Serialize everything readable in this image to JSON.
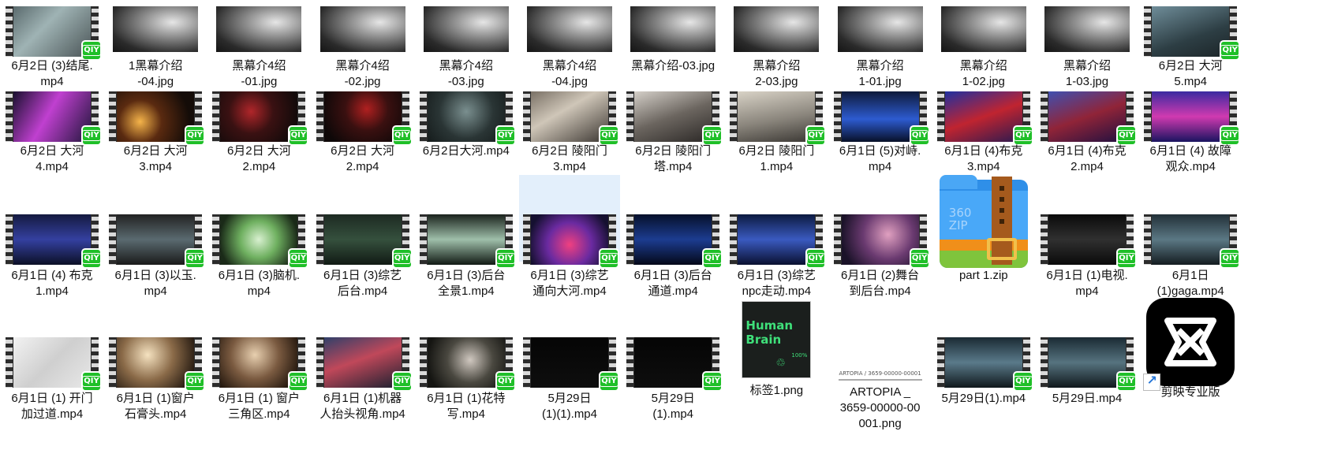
{
  "files": [
    {
      "name": "6月2日 (3)结尾.mp4",
      "type": "video",
      "label_lines": [
        "6月2日 (3)结尾.",
        "mp4"
      ],
      "frame": "linear-gradient(135deg,#5a6a6d,#9fb3b4 40%,#4b5557)"
    },
    {
      "name": "1黑幕介绍-04.jpg",
      "type": "image",
      "label_lines": [
        "1黑幕介绍",
        "-04.jpg"
      ]
    },
    {
      "name": "黑幕介4绍-01.jpg",
      "type": "image",
      "label_lines": [
        "黑幕介4绍",
        "-01.jpg"
      ]
    },
    {
      "name": "黑幕介4绍-02.jpg",
      "type": "image",
      "label_lines": [
        "黑幕介4绍",
        "-02.jpg"
      ]
    },
    {
      "name": "黑幕介4绍-03.jpg",
      "type": "image",
      "label_lines": [
        "黑幕介4绍",
        "-03.jpg"
      ]
    },
    {
      "name": "黑幕介4绍-04.jpg",
      "type": "image",
      "label_lines": [
        "黑幕介4绍",
        "-04.jpg"
      ]
    },
    {
      "name": "黑幕介绍-03.jpg",
      "type": "image",
      "label_lines": [
        "黑幕介绍-03.jpg"
      ]
    },
    {
      "name": "黑幕介绍2-03.jpg",
      "type": "image",
      "label_lines": [
        "黑幕介绍",
        "2-03.jpg"
      ]
    },
    {
      "name": "黑幕介绍1-01.jpg",
      "type": "image",
      "label_lines": [
        "黑幕介绍",
        "1-01.jpg"
      ]
    },
    {
      "name": "黑幕介绍1-02.jpg",
      "type": "image",
      "label_lines": [
        "黑幕介绍",
        "1-02.jpg"
      ]
    },
    {
      "name": "黑幕介绍1-03.jpg",
      "type": "image",
      "label_lines": [
        "黑幕介绍",
        "1-03.jpg"
      ]
    },
    {
      "name": "6月2日 大河5.mp4",
      "type": "video",
      "label_lines": [
        "6月2日 大河",
        "5.mp4"
      ],
      "frame": "linear-gradient(160deg,#6f8d99,#2d3e44 60%,#1c2528)"
    },
    {
      "name": "6月2日 大河4.mp4",
      "type": "video",
      "label_lines": [
        "6月2日 大河",
        "4.mp4"
      ],
      "frame": "linear-gradient(120deg,#1a1030,#c040d0 45%,#20163a)"
    },
    {
      "name": "6月2日 大河3.mp4",
      "type": "video",
      "label_lines": [
        "6月2日 大河",
        "3.mp4"
      ],
      "frame": "radial-gradient(circle at 30% 60%,#f5b44a,#5a2a10 35%,#140c08 80%)"
    },
    {
      "name": "6月2日 大河2.mp4",
      "type": "video",
      "label_lines": [
        "6月2日 大河",
        "2.mp4"
      ],
      "frame": "radial-gradient(circle at 40% 40%,#b0262a,#3a1112 40%,#120a0a 85%)"
    },
    {
      "name": "6月2日 大河2.mp4",
      "type": "video",
      "label_lines": [
        "6月2日 大河",
        "2.mp4"
      ],
      "frame": "radial-gradient(circle at 55% 35%,#b02020,#3a1010 40%,#0e0808 85%)"
    },
    {
      "name": "6月2日大河.mp4",
      "type": "video",
      "label_lines": [
        "6月2日大河.mp4"
      ],
      "frame": "radial-gradient(circle at 50% 40%,#7a8f8f,#2a3535 55%,#151b1b)"
    },
    {
      "name": "6月2日 陵阳门3.mp4",
      "type": "video",
      "label_lines": [
        "6月2日 陵阳门",
        "3.mp4"
      ],
      "frame": "linear-gradient(150deg,#7a7166,#cfc6b8 40%,#3b3631)"
    },
    {
      "name": "6月2日 陵阳门塔.mp4",
      "type": "video",
      "label_lines": [
        "6月2日 陵阳门",
        "塔.mp4"
      ],
      "frame": "linear-gradient(160deg,#d4cfc8,#6b655f 50%,#2b2826)"
    },
    {
      "name": "6月2日 陵阳门1.mp4",
      "type": "video",
      "label_lines": [
        "6月2日 陵阳门",
        "1.mp4"
      ],
      "frame": "linear-gradient(170deg,#d8d2c6,#8a857c 55%,#3a3733)"
    },
    {
      "name": "6月1日 (5)对峙.mp4",
      "type": "video",
      "label_lines": [
        "6月1日 (5)对峙.",
        "mp4"
      ],
      "frame": "linear-gradient(180deg,#0e1a3a,#2d5bd0 55%,#081028)"
    },
    {
      "name": "6月1日 (4)布克3.mp4",
      "type": "video",
      "label_lines": [
        "6月1日 (4)布克",
        "3.mp4"
      ],
      "frame": "linear-gradient(160deg,#2030a0,#c02430 50%,#2a1a50)"
    },
    {
      "name": "6月1日 (4)布克2.mp4",
      "type": "video",
      "label_lines": [
        "6月1日 (4)布克",
        "2.mp4"
      ],
      "frame": "linear-gradient(160deg,#4050b0,#902438 50%,#201040)"
    },
    {
      "name": "6月1日 (4) 故障观众.mp4",
      "type": "video",
      "label_lines": [
        "6月1日 (4) 故障",
        "观众.mp4"
      ],
      "frame": "linear-gradient(180deg,#3a2aa0,#d03ab0 50%,#1a1460)"
    },
    {
      "name": "6月1日 (4) 布克1.mp4",
      "type": "video",
      "label_lines": [
        "6月1日 (4) 布克",
        "1.mp4"
      ],
      "frame": "linear-gradient(180deg,#141a40,#3440a0 50%,#0c1026)"
    },
    {
      "name": "6月1日 (3)以玉.mp4",
      "type": "video",
      "label_lines": [
        "6月1日 (3)以玉.",
        "mp4"
      ],
      "frame": "linear-gradient(180deg,#222,#5a6a70 50%,#1a1a1a)"
    },
    {
      "name": "6月1日 (3)脑机.mp4",
      "type": "video",
      "label_lines": [
        "6月1日 (3)脑机.",
        "mp4"
      ],
      "frame": "radial-gradient(circle at 50% 50%,#d8f0d0,#6fb060 40%,#1a2a18 85%)"
    },
    {
      "name": "6月1日 (3)综艺后台.mp4",
      "type": "video",
      "label_lines": [
        "6月1日 (3)综艺",
        "后台.mp4"
      ],
      "frame": "linear-gradient(180deg,#1d2a22,#35503d 50%,#111a14)"
    },
    {
      "name": "6月1日 (3)后台全景1.mp4",
      "type": "video",
      "label_lines": [
        "6月1日 (3)后台",
        "全景1.mp4"
      ],
      "frame": "linear-gradient(180deg,#1a221c,#9fbfaa 50%,#111a14)"
    },
    {
      "name": "6月1日 (3)综艺通向大河.mp4",
      "type": "video",
      "label_lines": [
        "6月1日 (3)综艺",
        "通向大河.mp4"
      ],
      "frame": "radial-gradient(circle at 50% 60%,#f04080,#6a2aa0 45%,#151030 85%)",
      "selected": true
    },
    {
      "name": "6月1日 (3)后台通道.mp4",
      "type": "video",
      "label_lines": [
        "6月1日 (3)后台",
        "通道.mp4"
      ],
      "frame": "linear-gradient(180deg,#06102a,#1c3c90 50%,#040818)"
    },
    {
      "name": "6月1日 (3)综艺npc走动.mp4",
      "type": "video",
      "label_lines": [
        "6月1日 (3)综艺",
        "npc走动.mp4"
      ],
      "frame": "linear-gradient(180deg,#0c1a40,#3a5ac0 50%,#0a1030)"
    },
    {
      "name": "6月1日 (2)舞台到后台.mp4",
      "type": "video",
      "label_lines": [
        "6月1日 (2)舞台",
        "到后台.mp4"
      ],
      "frame": "radial-gradient(circle at 60% 40%,#e0a0c0,#6a3a70 45%,#1a1228 85%)"
    },
    {
      "name": "part 1.zip",
      "type": "zip",
      "label_lines": [
        "part 1.zip"
      ],
      "zip_text": [
        "360",
        "ZIP"
      ]
    },
    {
      "name": "6月1日 (1)电视.mp4",
      "type": "video",
      "label_lines": [
        "6月1日 (1)电视.",
        "mp4"
      ],
      "frame": "linear-gradient(180deg,#0a0a0a,#303030 50%,#0a0a0a)"
    },
    {
      "name": "6月1日 (1)gaga.mp4",
      "type": "video",
      "label_lines": [
        "6月1日",
        "(1)gaga.mp4"
      ],
      "frame": "linear-gradient(180deg,#223038,#5b7884 50%,#141c20)"
    },
    {
      "name": "6月1日 (1) 开门加过道.mp4",
      "type": "video",
      "label_lines": [
        "6月1日 (1) 开门",
        "加过道.mp4"
      ],
      "frame": "linear-gradient(135deg,#f2f2f2,#cfcfcf 50%,#e8e8e8)"
    },
    {
      "name": "6月1日 (1)窗户石膏头.mp4",
      "type": "video",
      "label_lines": [
        "6月1日 (1)窗户",
        "石膏头.mp4"
      ],
      "frame": "radial-gradient(circle at 40% 35%,#f5e2c0,#8a6a48 45%,#2a1e14 85%)"
    },
    {
      "name": "6月1日 (1) 窗户三角区.mp4",
      "type": "video",
      "label_lines": [
        "6月1日 (1) 窗户",
        "三角区.mp4"
      ],
      "frame": "radial-gradient(circle at 45% 35%,#e8d0b0,#7a5a40 45%,#26190f 85%)"
    },
    {
      "name": "6月1日 (1)机器人抬头视角.mp4",
      "type": "video",
      "label_lines": [
        "6月1日 (1)机器",
        "人抬头视角.mp4"
      ],
      "frame": "linear-gradient(160deg,#30406a,#c0485a 45%,#1a2030)"
    },
    {
      "name": "6月1日 (1)花特写.mp4",
      "type": "video",
      "label_lines": [
        "6月1日 (1)花特",
        "写.mp4"
      ],
      "frame": "radial-gradient(circle at 55% 45%,#d0c8c0,#4a4840 45%,#151512 85%)"
    },
    {
      "name": "5月29日(1)(1).mp4",
      "type": "video",
      "label_lines": [
        "5月29日",
        "(1)(1).mp4"
      ],
      "frame": "linear-gradient(180deg,#050505,#0e0e0e)"
    },
    {
      "name": "5月29日(1).mp4",
      "type": "video",
      "label_lines": [
        "5月29日",
        "(1).mp4"
      ],
      "frame": "linear-gradient(180deg,#050505,#0e0e0e)"
    },
    {
      "name": "标签1.png",
      "type": "png_brain",
      "label_lines": [
        "标签1.png"
      ],
      "brain_text": [
        "Human",
        "Brain"
      ],
      "brain_pct": "100%"
    },
    {
      "name": "ARTOPIA _3659-00000-00001.png",
      "type": "png_artopia",
      "label_lines": [
        "ARTOPIA _",
        "3659-00000-00",
        "001.png"
      ],
      "thumb_text": "ARTOPIA / 3659-00000-00001"
    },
    {
      "name": "5月29日(1).mp4",
      "type": "video",
      "label_lines": [
        "5月29日(1).mp4"
      ],
      "frame": "linear-gradient(180deg,#1a2a33,#5a7a8a 50%,#10181c)"
    },
    {
      "name": "5月29日.mp4",
      "type": "video",
      "label_lines": [
        "5月29日.mp4"
      ],
      "frame": "linear-gradient(180deg,#1a2a33,#56737f 50%,#10181c)"
    },
    {
      "name": "剪映专业版",
      "type": "shortcut_capcut",
      "label_lines": [
        "剪映专业版"
      ]
    }
  ],
  "badge_text": "QIY",
  "selection_color": "#e3effb"
}
